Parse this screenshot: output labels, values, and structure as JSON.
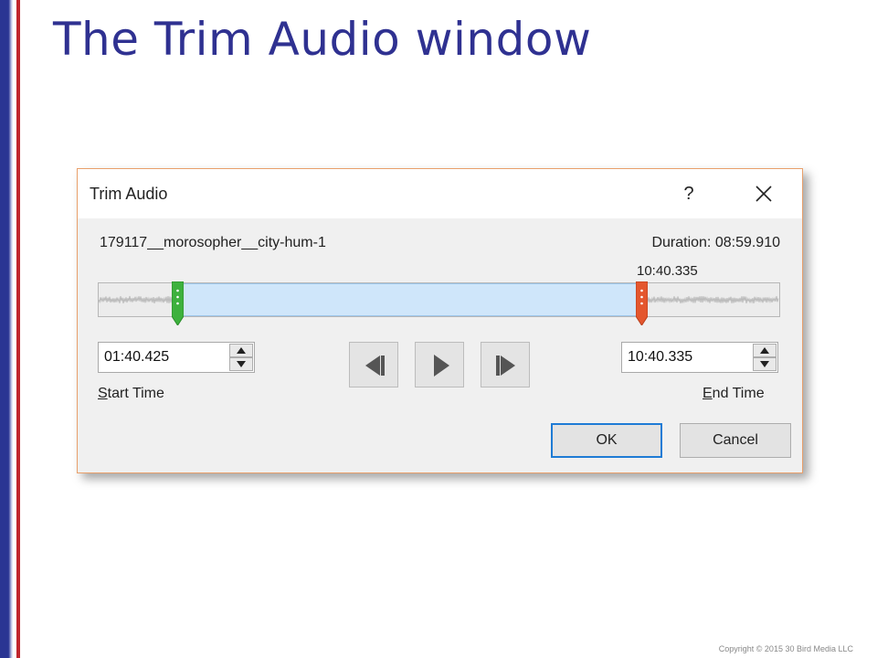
{
  "slide": {
    "title": "The Trim Audio window",
    "copyright": "Copyright © 2015 30 Bird Media LLC"
  },
  "dialog": {
    "title": "Trim Audio",
    "help_label": "?",
    "file_name": "179117__morosopher__city-hum-1",
    "duration": "Duration: 08:59.910",
    "end_marker_time": "10:40.335",
    "start_time": {
      "value": "01:40.425",
      "label_accel": "S",
      "label_rest": "tart Time"
    },
    "end_time": {
      "value": "10:40.335",
      "label_accel": "E",
      "label_rest": "nd Time"
    },
    "ok_label": "OK",
    "cancel_label": "Cancel"
  },
  "colors": {
    "title": "#2f3191",
    "start_handle": "#3db13d",
    "end_handle": "#e4572e",
    "selection": "#cfe6fa",
    "ok_border": "#1e7bd5"
  },
  "icons": {
    "previous": "previous-frame-icon",
    "play": "play-icon",
    "next": "next-frame-icon",
    "close": "close-icon"
  }
}
